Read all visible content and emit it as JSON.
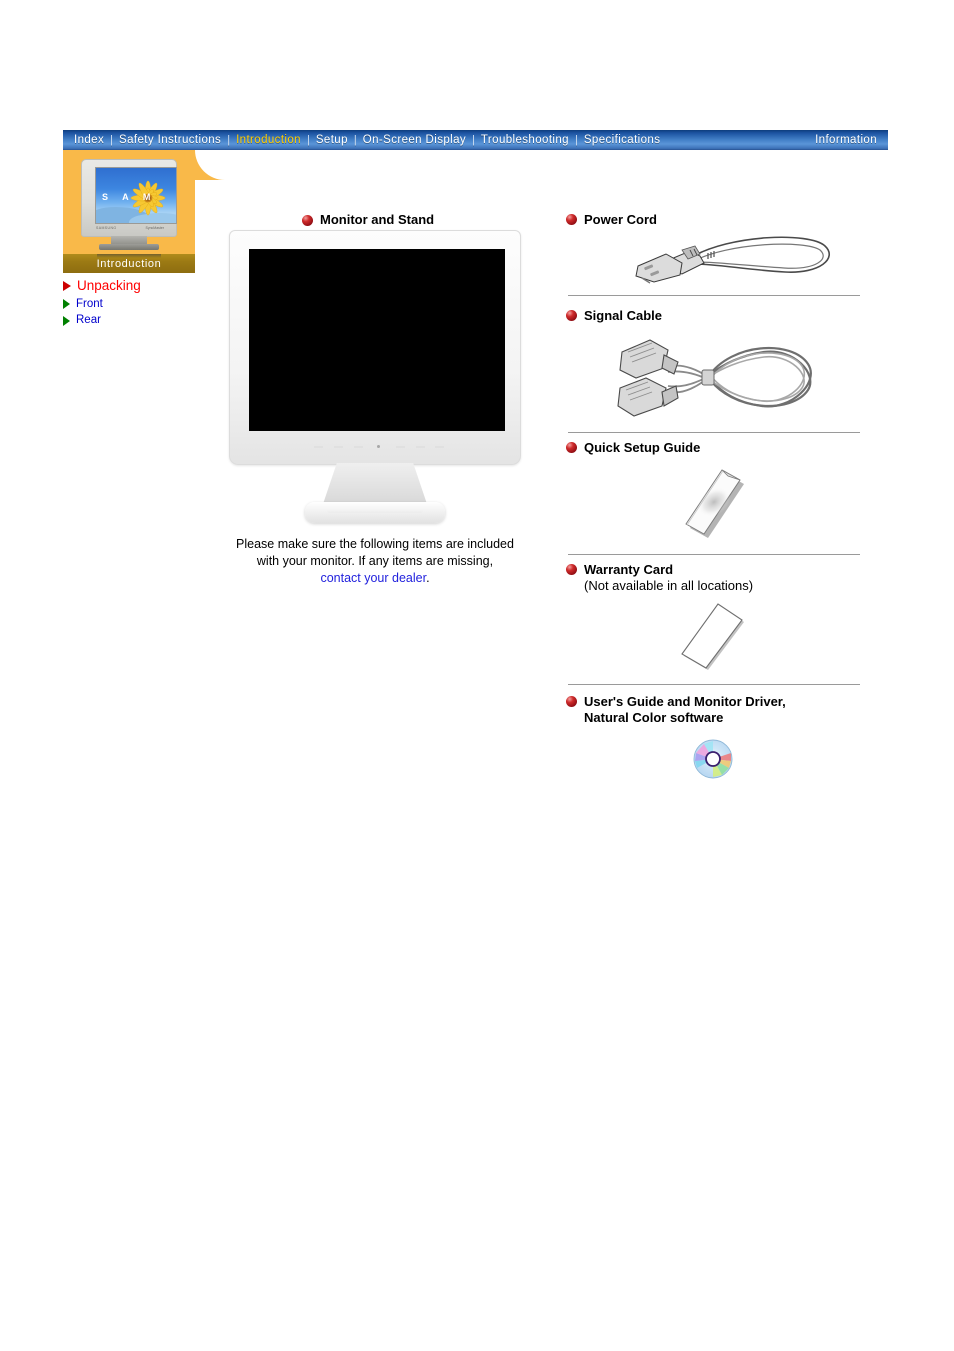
{
  "nav": {
    "items": [
      {
        "label": "Index",
        "active": false
      },
      {
        "label": "Safety Instructions",
        "active": false
      },
      {
        "label": "Introduction",
        "active": true
      },
      {
        "label": "Setup",
        "active": false
      },
      {
        "label": "On-Screen Display",
        "active": false
      },
      {
        "label": "Troubleshooting",
        "active": false
      },
      {
        "label": "Specifications",
        "active": false
      },
      {
        "label": "Information",
        "active": false
      }
    ],
    "separator": "|",
    "active_color": "#ffcc00",
    "bar_color": "#3f7cc4"
  },
  "sidebar": {
    "panel_color": "#f9b949",
    "label_bar_color": "#9c7a14",
    "section_label": "Introduction",
    "thumbnail": {
      "screen_text": "S A M",
      "brand_text": "SAMSUNG",
      "model_text": "SyncMaster",
      "icon": "crt-monitor-sunflower-icon"
    },
    "items": [
      {
        "label": "Unpacking",
        "color": "#ff0000",
        "marker": "red-triangle-icon",
        "current": true
      },
      {
        "label": "Front",
        "color": "#0000cc",
        "marker": "green-triangle-icon",
        "current": false
      },
      {
        "label": "Rear",
        "color": "#0000cc",
        "marker": "green-triangle-icon",
        "current": false
      }
    ]
  },
  "main": {
    "monitor_item": {
      "title": "Monitor and Stand",
      "bullet": "red-sphere-bullet-icon",
      "image": "lcd-monitor-and-stand-icon"
    },
    "caption": {
      "line1": "Please make sure the following items are included",
      "line2": "with your monitor. If any items are missing,",
      "link": "contact your dealer",
      "period": "."
    }
  },
  "accessories": [
    {
      "title": "Power Cord",
      "subtitle": "",
      "bullet": "red-sphere-bullet-icon",
      "image": "power-cord-icon"
    },
    {
      "title": "Signal Cable",
      "subtitle": "",
      "bullet": "red-sphere-bullet-icon",
      "image": "signal-cable-icon"
    },
    {
      "title": "Quick Setup Guide",
      "subtitle": "",
      "bullet": "red-sphere-bullet-icon",
      "image": "quick-setup-guide-booklet-icon"
    },
    {
      "title": "Warranty Card",
      "subtitle": "(Not available in all locations)",
      "bullet": "red-sphere-bullet-icon",
      "image": "warranty-card-icon"
    },
    {
      "title": "User's Guide and Monitor Driver,",
      "title2": "Natural Color software",
      "subtitle": "",
      "bullet": "red-sphere-bullet-icon",
      "image": "cd-rom-disc-icon"
    }
  ]
}
